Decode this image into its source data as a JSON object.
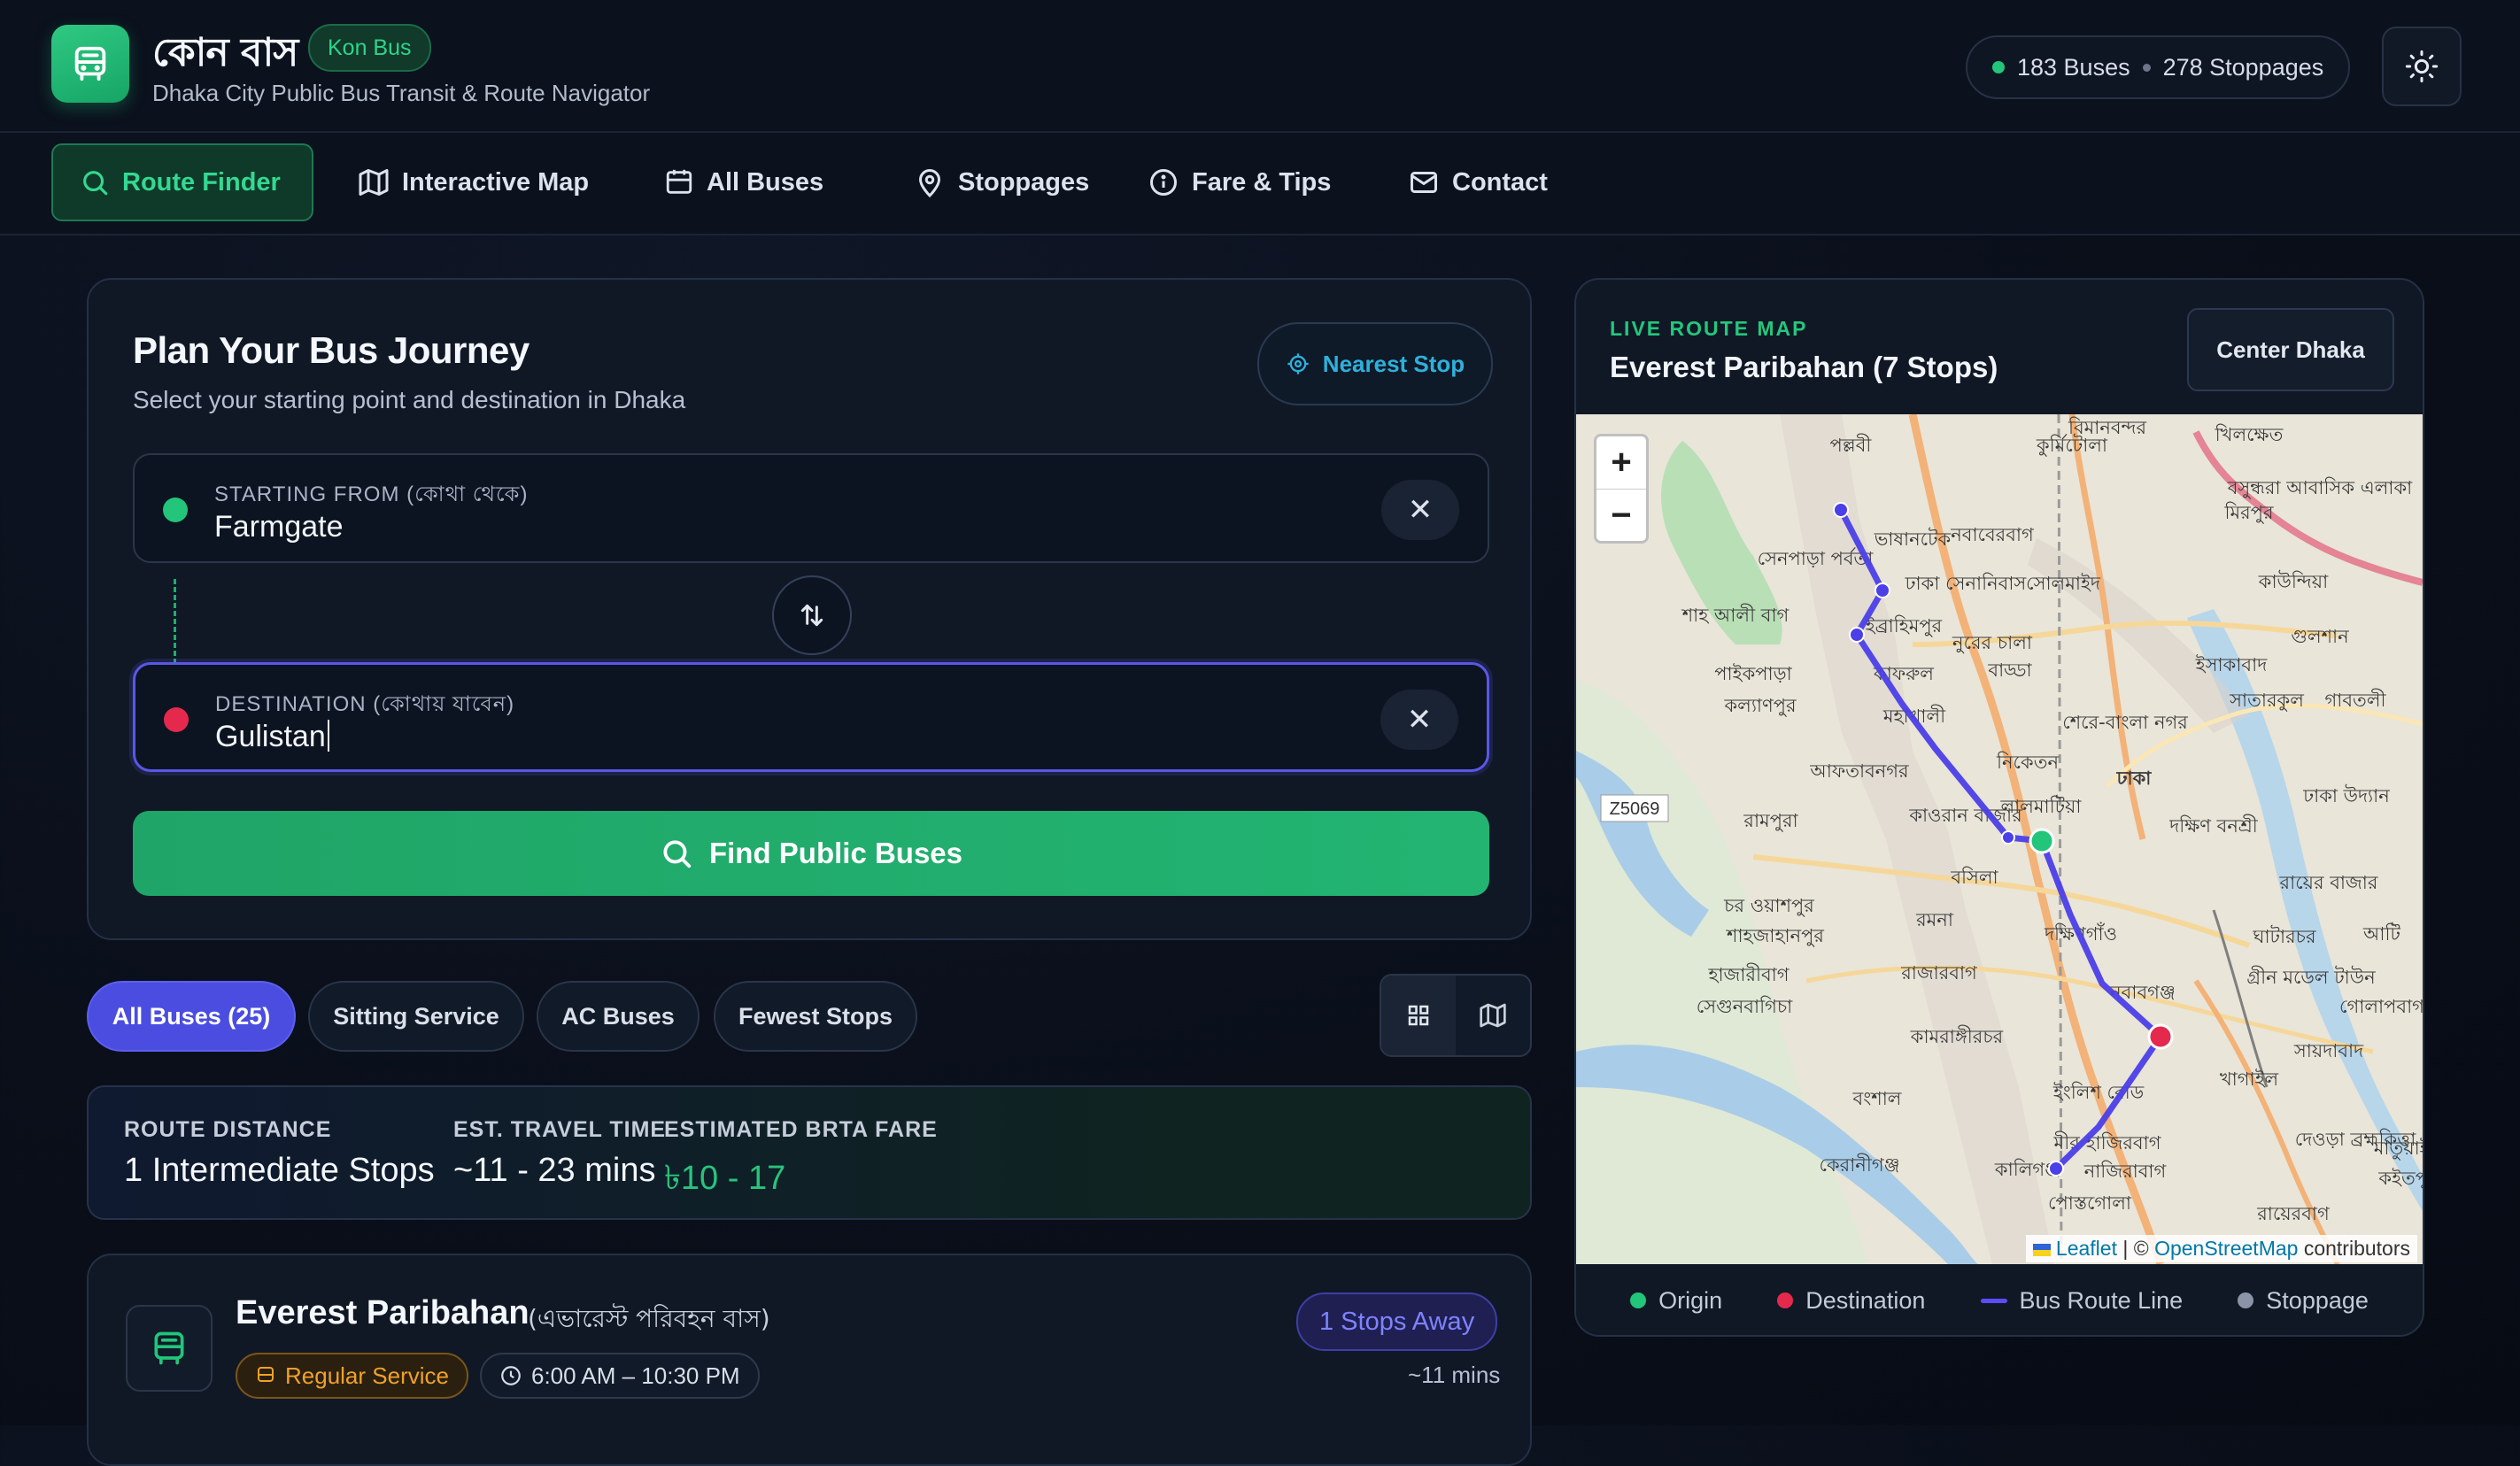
{
  "app": {
    "title": "কোন বাস",
    "badge": "Kon Bus",
    "subtitle": "Dhaka City Public Bus Transit & Route Navigator",
    "buses_stat": "183 Buses",
    "stoppages_stat": "278 Stoppages",
    "accent": "#22c57a"
  },
  "nav": [
    {
      "label": "Route Finder",
      "icon": "search-icon"
    },
    {
      "label": "Interactive Map",
      "icon": "map-icon"
    },
    {
      "label": "All Buses",
      "icon": "bus-list-icon"
    },
    {
      "label": "Stoppages",
      "icon": "pin-icon"
    },
    {
      "label": "Fare & Tips",
      "icon": "info-icon"
    },
    {
      "label": "Contact",
      "icon": "mail-icon"
    }
  ],
  "journey": {
    "title": "Plan Your Bus Journey",
    "subtitle": "Select your starting point and destination in Dhaka",
    "nearest_label": "Nearest Stop",
    "from_label": "STARTING FROM (কোথা থেকে)",
    "from_value": "Farmgate",
    "to_label": "DESTINATION (কোথায় যাবেন)",
    "to_value": "Gulistan",
    "find_label": "Find Public Buses",
    "clear_glyph": "✕"
  },
  "filters": [
    {
      "label": "All Buses (25)",
      "active": true
    },
    {
      "label": "Sitting Service",
      "active": false
    },
    {
      "label": "AC Buses",
      "active": false
    },
    {
      "label": "Fewest Stops",
      "active": false
    }
  ],
  "summary": {
    "distance_label": "ROUTE DISTANCE",
    "distance_value": "1 Intermediate Stops",
    "time_label": "EST. TRAVEL TIME",
    "time_value": "~11 - 23 mins",
    "fare_label": "ESTIMATED BRTA FARE",
    "fare_value": "৳10 - 17"
  },
  "result": {
    "name": "Everest Paribahan",
    "name_bn": "(এভারেস্ট পরিবহন বাস)",
    "service": "Regular Service",
    "hours": "6:00 AM – 10:30 PM",
    "stops_away": "1 Stops Away",
    "eta": "~11 mins"
  },
  "map": {
    "kicker": "LIVE ROUTE MAP",
    "title": "Everest Paribahan (7 Stops)",
    "center_label": "Center Dhaka",
    "zoom_in": "+",
    "zoom_out": "−",
    "attribution_leaflet": "Leaflet",
    "attribution_sep": " | © ",
    "attribution_osm": "OpenStreetMap",
    "attribution_tail": " contributors",
    "road_tag": "Z5069",
    "places": [
      "পল্লবী",
      "কুর্মিটোলা",
      "খিলক্ষেত",
      "বিমানবন্দর",
      "বসুন্ধরা আবাসিক এলাকা",
      "মিরপুর",
      "ভাষানটেক",
      "নবাবেরবাগ",
      "সেনপাড়া পর্বতা",
      "ঢাকা সেনানিবাস",
      "সোলমাইদ",
      "কাউন্দিয়া",
      "শাহ আলী বাগ",
      "ইব্রাহিমপুর",
      "নুরের চালা",
      "গুলশান",
      "ইসাকাবাদ",
      "পাইকপাড়া",
      "কাফরুল",
      "বাড্ডা",
      "সাতারকুল",
      "গাবতলী",
      "কল্যাণপুর",
      "মহাখালী",
      "শেরে-বাংলা নগর",
      "নিকেতন",
      "আফতাবনগর",
      "ঢাকা",
      "ঢাকা উদ্যান",
      "লালমাটিয়া",
      "রামপুরা",
      "কাওরান বাজার",
      "দক্ষিণ বনশ্রী",
      "বসিলা",
      "রায়ের বাজার",
      "চর ওয়াশপুর",
      "রমনা",
      "শাহজাহানপুর",
      "দক্ষিণগাঁও",
      "ঘাটারচর",
      "আটি",
      "হাজারীবাগ",
      "সেগুনবাগিচা",
      "রাজারবাগ",
      "নবাবগঞ্জ",
      "গ্রীন মডেল টাউন",
      "কামরাঙ্গীরচর",
      "গোলাপবাগ",
      "সায়দাবাদ",
      "খাগাইল",
      "বংশাল",
      "ইংলিশ রোড",
      "মীর হাজিরবাগ",
      "দেওড়া ব্রহ্মকিত্তা",
      "কেরানীগঞ্জ",
      "কালিগঞ্জ",
      "নাজিরাবাগ",
      "পোস্তগোলা",
      "রায়েরবাগ",
      "মাতুয়াইল",
      "কইতপুর"
    ],
    "legend": [
      {
        "label": "Origin",
        "color": "#22c57a"
      },
      {
        "label": "Destination",
        "color": "#e5294d"
      },
      {
        "label": "Bus Route Line",
        "color": "#5b4dff"
      },
      {
        "label": "Stoppage",
        "color": "#8a94a6"
      }
    ]
  }
}
